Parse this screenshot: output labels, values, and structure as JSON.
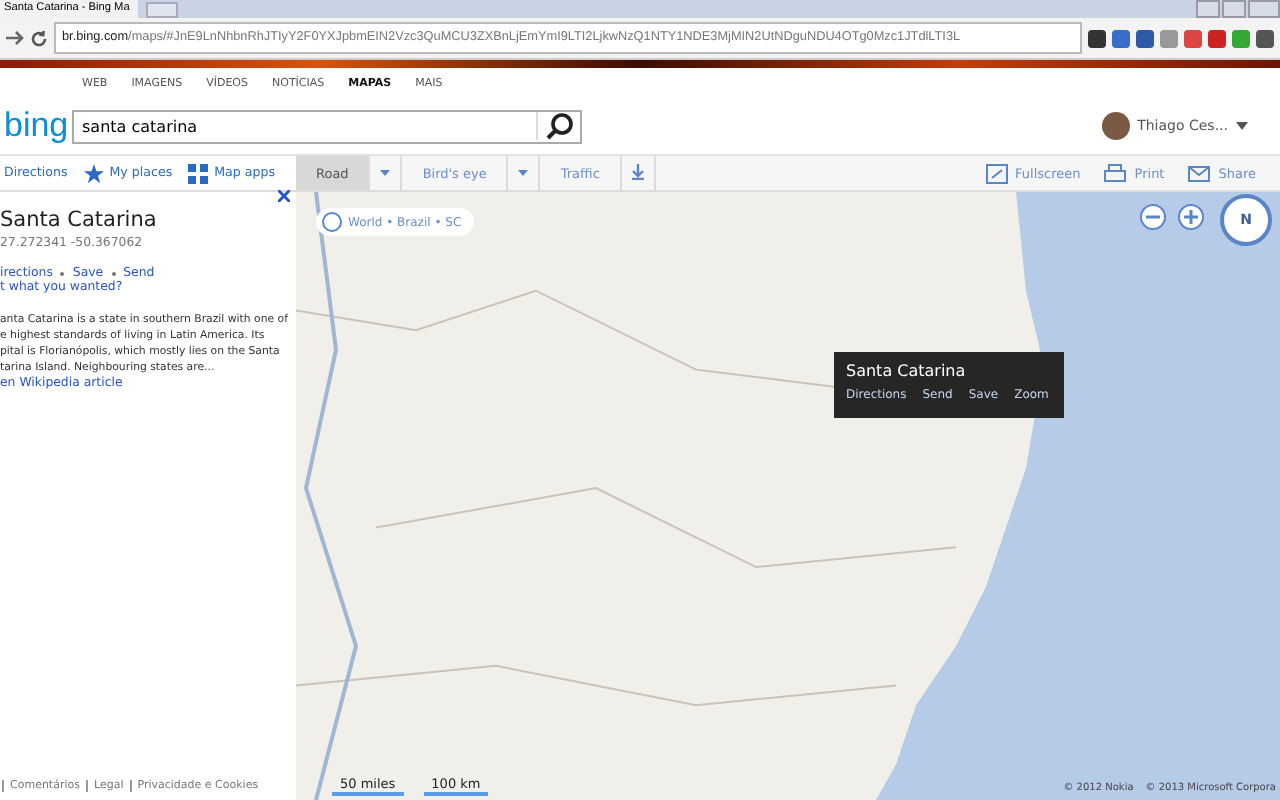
{
  "browser": {
    "tab_title": "Santa Catarina - Bing Ma",
    "url_host": "br.bing.com",
    "url_path": "/maps/#JnE9LnNhbnRhJTIyY2F0YXJpbmEIN2Vzc3QuMCU3ZXBnLjEmYmI9LTI2LjkwNzQ1NTY1NDE3MjMIN2UtNDguNDU4OTg0Mzc1JTdlLTI3L"
  },
  "nav": [
    {
      "label": "WEB",
      "selected": false
    },
    {
      "label": "IMAGENS",
      "selected": false
    },
    {
      "label": "VÍDEOS",
      "selected": false
    },
    {
      "label": "NOTÍCIAS",
      "selected": false
    },
    {
      "label": "MAPAS",
      "selected": true
    },
    {
      "label": "MAIS",
      "selected": false
    }
  ],
  "logo": "bing",
  "search": {
    "value": "santa catarina"
  },
  "user": {
    "name": "Thiago Ces..."
  },
  "panel_tools": [
    {
      "label": "Directions",
      "kind": "arrow"
    },
    {
      "label": "My places",
      "kind": "star"
    },
    {
      "label": "Map apps",
      "kind": "grid"
    }
  ],
  "map_tabs": [
    {
      "label": "Road",
      "selected": true,
      "dropdown": true
    },
    {
      "label": "Bird's eye",
      "selected": false,
      "dropdown": true
    },
    {
      "label": "Traffic",
      "selected": false,
      "dropdown": false
    }
  ],
  "map_actions": [
    {
      "label": "Fullscreen",
      "kind": "fullscreen"
    },
    {
      "label": "Print",
      "kind": "print"
    },
    {
      "label": "Share",
      "kind": "mail"
    }
  ],
  "result": {
    "title": "Santa Catarina",
    "coords": "27.272341 -50.367062",
    "links": [
      "irections",
      "Save",
      "Send"
    ],
    "not_wanted": "t what you wanted?",
    "description": [
      "anta Catarina is a state in southern Brazil with one of",
      "e highest standards of living in Latin America. Its",
      "pital is Florianópolis, which mostly lies on the Santa",
      "tarina Island. Neighbouring states are..."
    ],
    "wiki_link": "en Wikipedia article"
  },
  "footer": [
    "Comentários",
    "Legal",
    "Privacidade e Cookies"
  ],
  "map": {
    "breadcrumb": "World • Brazil • SC",
    "compass": "N",
    "popup": {
      "title": "Santa Catarina",
      "actions": [
        "Directions",
        "Send",
        "Save",
        "Zoom"
      ]
    },
    "scale": [
      "50 miles",
      "100 km"
    ],
    "copyright": [
      "© 2012 Nokia",
      "© 2013 Microsoft Corpora"
    ]
  }
}
